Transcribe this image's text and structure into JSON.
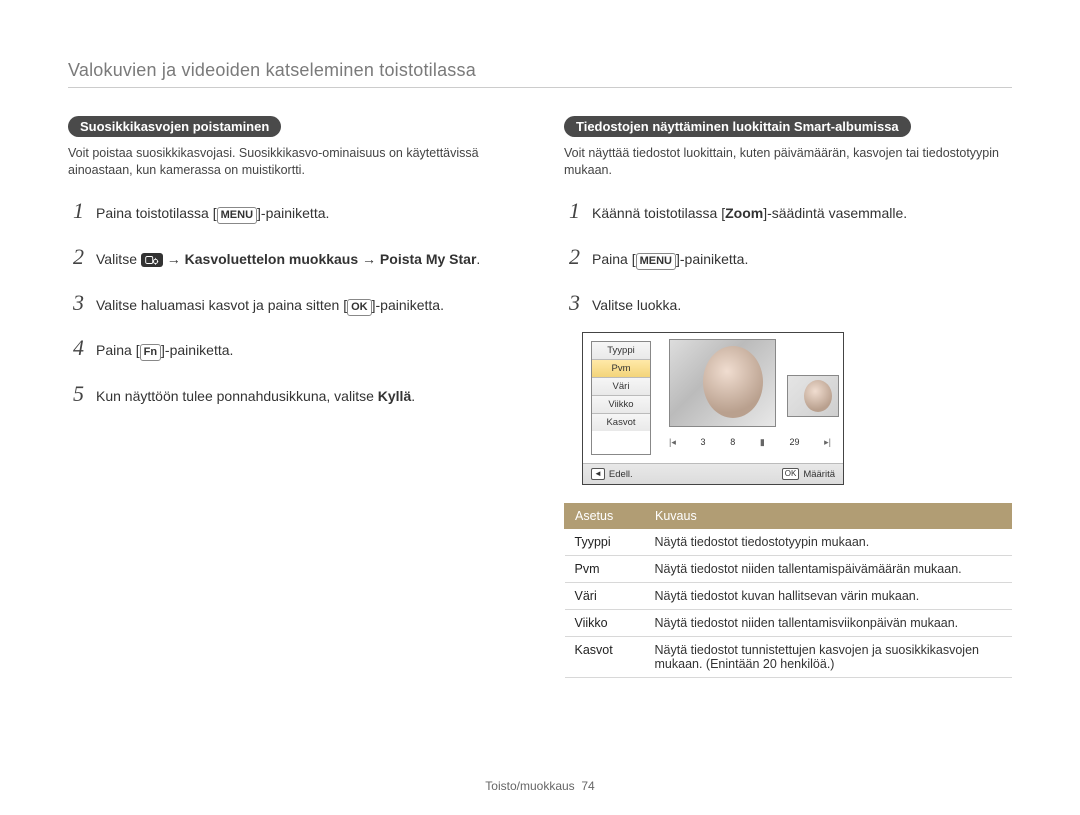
{
  "page_title": "Valokuvien ja videoiden katseleminen toistotilassa",
  "left": {
    "pill": "Suosikkikasvojen poistaminen",
    "intro": "Voit poistaa suosikkikasvojasi. Suosikkikasvo-ominaisuus on käytettävissä ainoastaan, kun kamerassa on muistikortti.",
    "steps": {
      "s1_a": "Paina toistotilassa [",
      "menu": "MENU",
      "s1_b": "]-painiketta.",
      "s2_a": "Valitse ",
      "s2_b": " → Kasvoluettelon muokkaus → Poista My Star",
      "s2_c": ".",
      "s3_a": "Valitse haluamasi kasvot ja paina sitten [",
      "ok": "OK",
      "s3_b": "]-painiketta.",
      "s4_a": "Paina [",
      "fn": "Fn",
      "s4_b": "]-painiketta.",
      "s5_a": "Kun näyttöön tulee ponnahdusikkuna, valitse ",
      "s5_b": "Kyllä",
      "s5_c": "."
    }
  },
  "right": {
    "pill": "Tiedostojen näyttäminen luokittain Smart-albumissa",
    "intro": "Voit näyttää tiedostot luokittain, kuten päivämäärän, kasvojen tai tiedostotyypin mukaan.",
    "steps": {
      "s1_a": "Käännä toistotilassa [",
      "zoom": "Zoom",
      "s1_b": "]-säädintä vasemmalle.",
      "s2_a": "Paina [",
      "menu": "MENU",
      "s2_b": "]-painiketta.",
      "s3": "Valitse luokka."
    },
    "screenshot": {
      "menu": [
        "Tyyppi",
        "Pvm",
        "Väri",
        "Viikko",
        "Kasvot"
      ],
      "strip_left": "3",
      "strip_mid": "8",
      "strip_right": "29",
      "footer_left": "Edell.",
      "footer_right": "Määritä",
      "footer_left_key": "◄",
      "footer_right_key": "OK"
    },
    "table": {
      "headers": [
        "Asetus",
        "Kuvaus"
      ],
      "rows": [
        [
          "Tyyppi",
          "Näytä tiedostot tiedostotyypin mukaan."
        ],
        [
          "Pvm",
          "Näytä tiedostot niiden tallentamispäivämäärän mukaan."
        ],
        [
          "Väri",
          "Näytä tiedostot kuvan hallitsevan värin mukaan."
        ],
        [
          "Viikko",
          "Näytä tiedostot niiden tallentamisviikonpäivän mukaan."
        ],
        [
          "Kasvot",
          "Näytä tiedostot tunnistettujen kasvojen ja suosikkikasvojen mukaan. (Enintään 20 henkilöä.)"
        ]
      ]
    }
  },
  "footer": {
    "section": "Toisto/muokkaus",
    "page": "74"
  }
}
